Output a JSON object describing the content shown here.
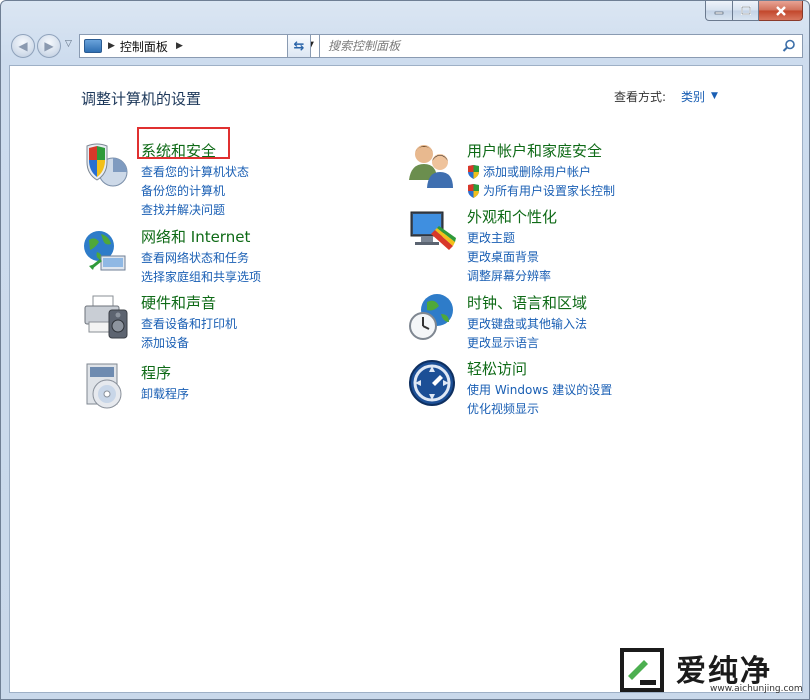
{
  "navigation": {
    "address_path": "控制面板",
    "search_placeholder": "搜索控制面板"
  },
  "header": {
    "title": "调整计算机的设置",
    "view_by_label": "查看方式:",
    "view_by_value": "类别"
  },
  "categories": [
    {
      "title": "系统和安全",
      "icon": "shield-security-icon",
      "links": [
        "查看您的计算机状态",
        "备份您的计算机",
        "查找并解决问题"
      ]
    },
    {
      "title": "网络和 Internet",
      "icon": "network-globe-icon",
      "links": [
        "查看网络状态和任务",
        "选择家庭组和共享选项"
      ]
    },
    {
      "title": "硬件和声音",
      "icon": "printer-speaker-icon",
      "links": [
        "查看设备和打印机",
        "添加设备"
      ]
    },
    {
      "title": "程序",
      "icon": "programs-disc-icon",
      "links": [
        "卸载程序"
      ]
    },
    {
      "title": "用户帐户和家庭安全",
      "icon": "users-icon",
      "links": [
        "添加或删除用户帐户",
        "为所有用户设置家长控制"
      ]
    },
    {
      "title": "外观和个性化",
      "icon": "monitor-paint-icon",
      "links": [
        "更改主题",
        "更改桌面背景",
        "调整屏幕分辨率"
      ]
    },
    {
      "title": "时钟、语言和区域",
      "icon": "clock-globe-icon",
      "links": [
        "更改键盘或其他输入法",
        "更改显示语言"
      ]
    },
    {
      "title": "轻松访问",
      "icon": "ease-of-access-icon",
      "links": [
        "使用 Windows 建议的设置",
        "优化视频显示"
      ]
    }
  ],
  "watermark": {
    "brand": "爱纯净",
    "url": "www.aichunjing.com"
  },
  "colors": {
    "link": "#1a5fb4",
    "category_title": "#0e6a16",
    "highlight_box": "#e03030"
  }
}
